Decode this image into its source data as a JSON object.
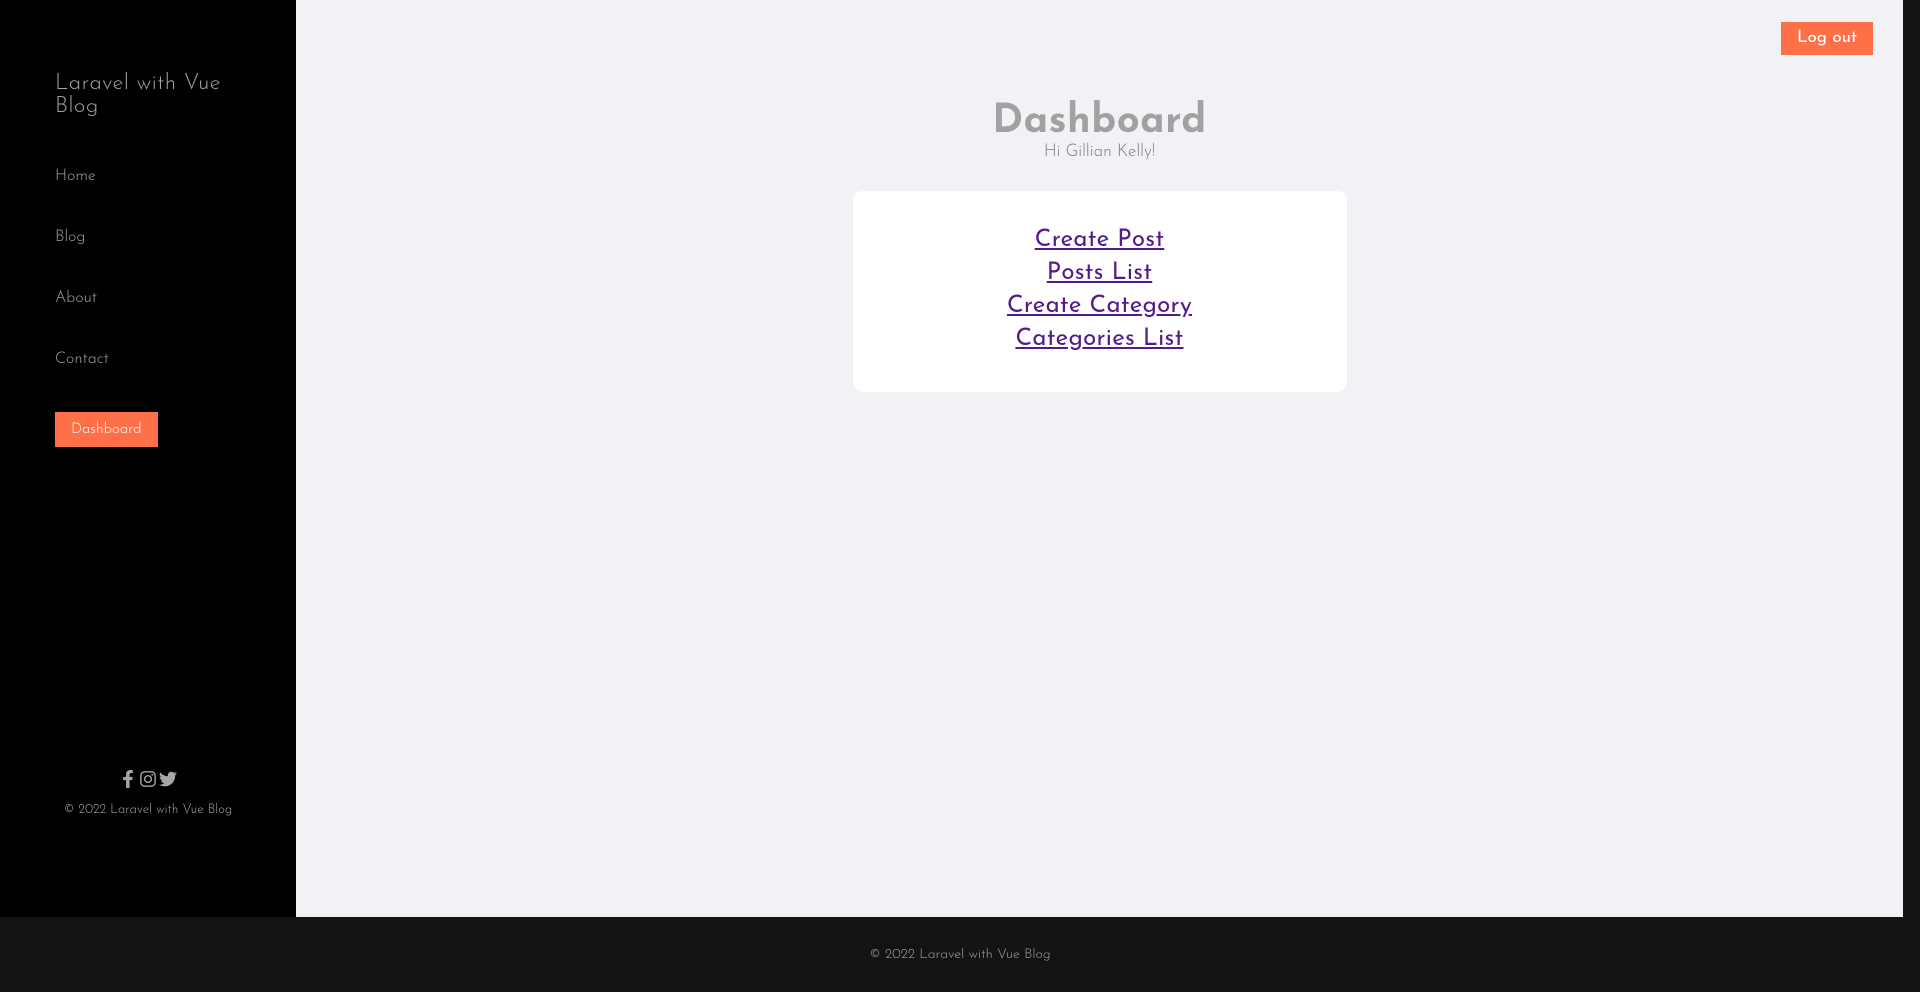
{
  "sidebar": {
    "title": "Laravel with Vue Blog",
    "nav": [
      {
        "label": "Home"
      },
      {
        "label": "Blog"
      },
      {
        "label": "About"
      },
      {
        "label": "Contact"
      }
    ],
    "dashboard_btn": "Dashboard",
    "copyright": "© 2022 Laravel with Vue Blog"
  },
  "header": {
    "logout": "Log out"
  },
  "main": {
    "title": "Dashboard",
    "greeting": "Hi Gillian Kelly!",
    "links": [
      {
        "label": "Create Post"
      },
      {
        "label": "Posts List"
      },
      {
        "label": "Create Category"
      },
      {
        "label": "Categories List"
      }
    ]
  },
  "footer": {
    "copyright": "© 2022 Laravel with Vue Blog"
  }
}
